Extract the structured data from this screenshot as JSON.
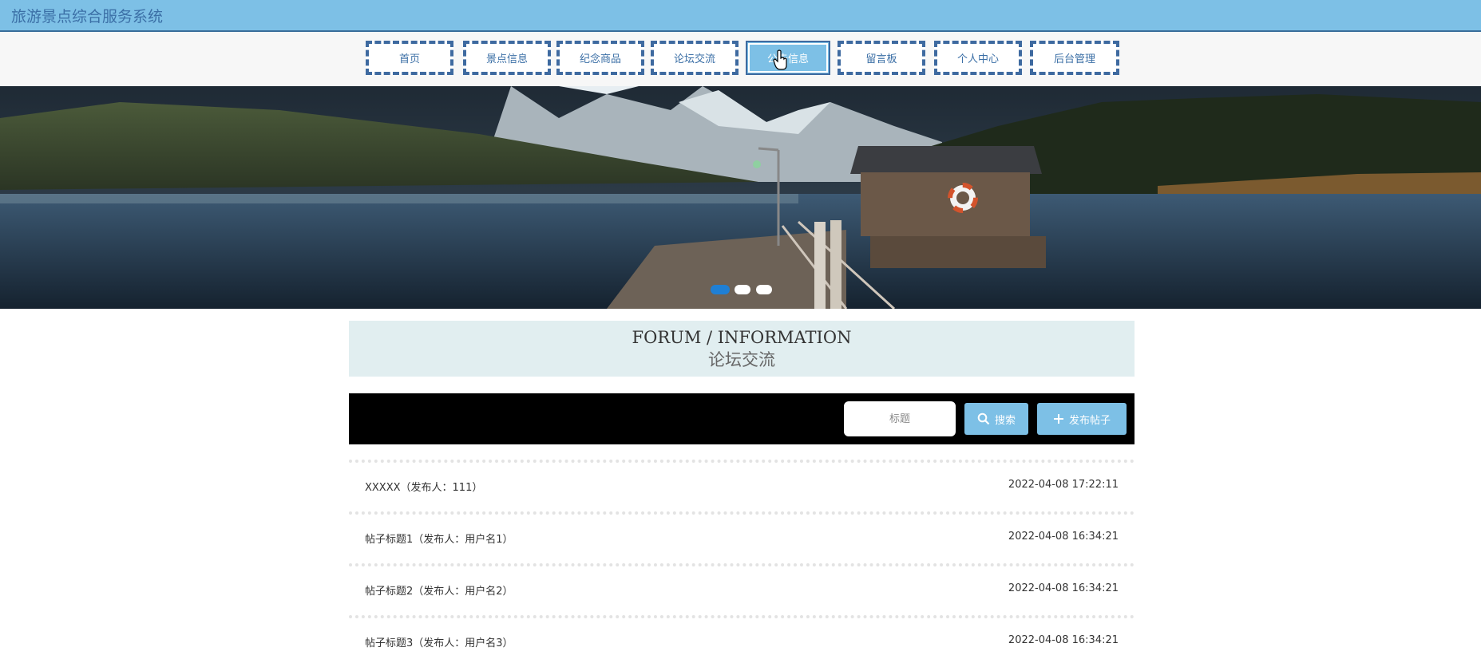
{
  "header": {
    "site_title": "旅游景点综合服务系统",
    "bar_color": "#7dc0e6"
  },
  "nav": {
    "items": [
      {
        "label": "首页",
        "active": false
      },
      {
        "label": "景点信息",
        "active": false
      },
      {
        "label": "纪念商品",
        "active": false
      },
      {
        "label": "论坛交流",
        "active": false
      },
      {
        "label": "公告信息",
        "active": true
      },
      {
        "label": "留言板",
        "active": false
      },
      {
        "label": "个人中心",
        "active": false
      },
      {
        "label": "后台管理",
        "active": false
      }
    ]
  },
  "carousel": {
    "slide_count": 3,
    "active_slide": 1
  },
  "section": {
    "title_en": "FORUM / INFORMATION",
    "title_cn": "论坛交流"
  },
  "search": {
    "placeholder": "标题",
    "search_label": "搜索",
    "publish_label": "发布帖子"
  },
  "posts": [
    {
      "title": "XXXXX（发布人：111）",
      "date": "2022-04-08 17:22:11"
    },
    {
      "title": "帖子标题1（发布人：用户名1）",
      "date": "2022-04-08 16:34:21"
    },
    {
      "title": "帖子标题2（发布人：用户名2）",
      "date": "2022-04-08 16:34:21"
    },
    {
      "title": "帖子标题3（发布人：用户名3）",
      "date": "2022-04-08 16:34:21"
    }
  ],
  "colors": {
    "accent": "#7dc0e6",
    "nav_border": "#3e6aa0",
    "section_bg": "#e1eef0",
    "toolbar_bg": "#000000"
  }
}
